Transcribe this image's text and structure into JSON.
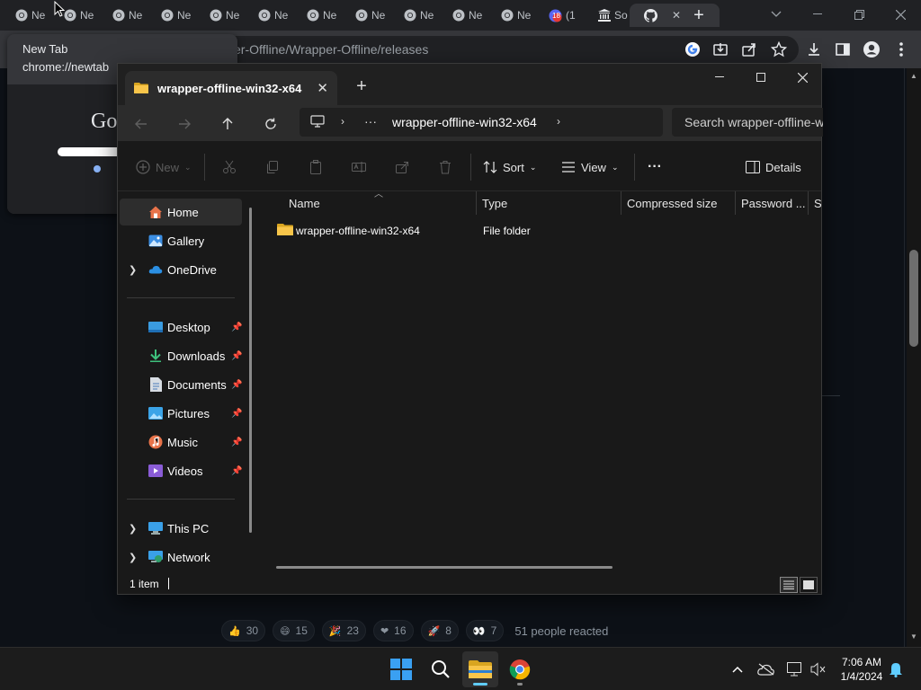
{
  "browser": {
    "tabs": [
      {
        "label": "Ne",
        "icon": "chrome-icon"
      },
      {
        "label": "Ne",
        "icon": "chrome-icon"
      },
      {
        "label": "Ne",
        "icon": "chrome-icon"
      },
      {
        "label": "Ne",
        "icon": "chrome-icon"
      },
      {
        "label": "Ne",
        "icon": "chrome-icon"
      },
      {
        "label": "Ne",
        "icon": "chrome-icon"
      },
      {
        "label": "Ne",
        "icon": "chrome-icon"
      },
      {
        "label": "Ne",
        "icon": "chrome-icon"
      },
      {
        "label": "Ne",
        "icon": "chrome-icon"
      },
      {
        "label": "Ne",
        "icon": "chrome-icon"
      },
      {
        "label": "Ne",
        "icon": "chrome-icon"
      },
      {
        "label": "(1",
        "icon": "notification-badge-icon",
        "badge": "18"
      },
      {
        "label": "So",
        "icon": "library-icon"
      },
      {
        "label": "",
        "icon": "github-icon"
      }
    ],
    "new_tab_symbol": "+",
    "address": "er-Offline/Wrapper-Offline/releases",
    "hover_card": {
      "title": "New Tab",
      "url": "chrome://newtab"
    },
    "reactions": [
      {
        "emoji": "👍",
        "count": "30"
      },
      {
        "emoji": "😄",
        "count": "15"
      },
      {
        "emoji": "🎉",
        "count": "23"
      },
      {
        "emoji": "❤",
        "count": "16"
      },
      {
        "emoji": "🚀",
        "count": "8"
      },
      {
        "emoji": "👀",
        "count": "7"
      }
    ],
    "reactions_summary": "51 people reacted"
  },
  "explorer": {
    "tab_title": "wrapper-offline-win32-x64",
    "breadcrumb": {
      "more": "···",
      "current": "wrapper-offline-win32-x64"
    },
    "search_placeholder": "Search wrapper-offline-w",
    "commands": {
      "new": "New",
      "sort": "Sort",
      "view": "View",
      "more": "···",
      "details": "Details"
    },
    "nav": {
      "home": "Home",
      "gallery": "Gallery",
      "onedrive": "OneDrive",
      "desktop": "Desktop",
      "downloads": "Downloads",
      "documents": "Documents",
      "pictures": "Pictures",
      "music": "Music",
      "videos": "Videos",
      "thispc": "This PC",
      "network": "Network"
    },
    "columns": {
      "name": "Name",
      "type": "Type",
      "compressed_size": "Compressed size",
      "password": "Password ...",
      "size": "Si"
    },
    "files": [
      {
        "name": "wrapper-offline-win32-x64",
        "type": "File folder"
      }
    ],
    "status": "1 item"
  },
  "taskbar": {
    "time": "7:06 AM",
    "date": "1/4/2024"
  },
  "colors": {
    "accent": "#60cdff",
    "folder": "#f8c54a",
    "chrome_bg": "#202124"
  }
}
